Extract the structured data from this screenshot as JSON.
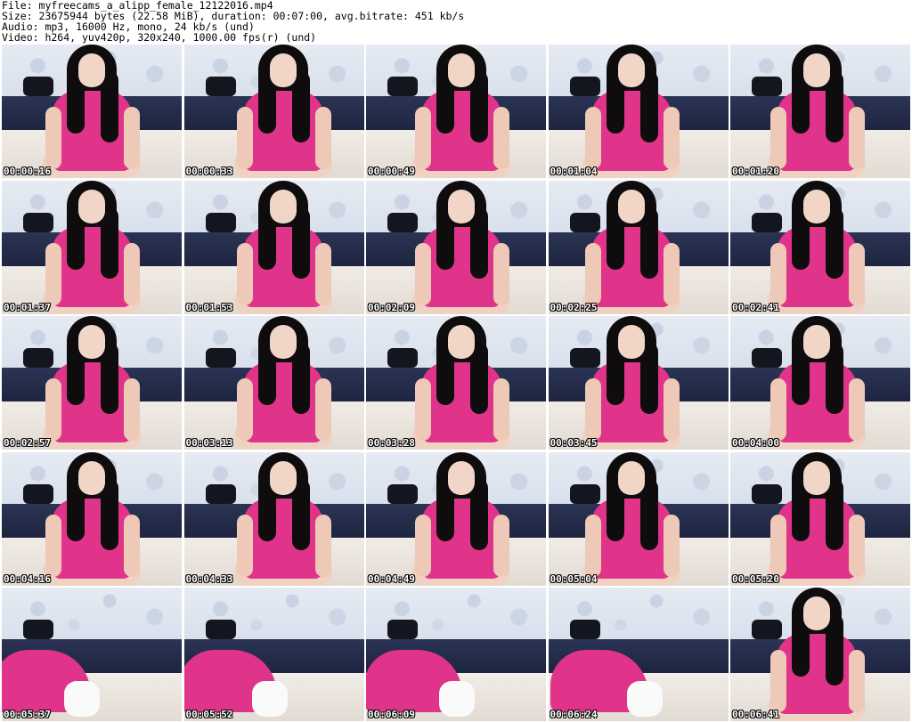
{
  "header": {
    "file": "File: myfreecams_a_alipp_female_12122016.mp4",
    "size": "Size: 23675944 bytes (22.58 MiB), duration: 00:07:00, avg.bitrate: 451 kb/s",
    "audio": "Audio: mp3, 16000 Hz, mono, 24 kb/s (und)",
    "video": "Video: h264, yuv420p, 320x240, 1000.00 fps(r) (und)"
  },
  "thumbnails": [
    {
      "time": "00:00:16"
    },
    {
      "time": "00:00:33"
    },
    {
      "time": "00:00:49"
    },
    {
      "time": "00:01:04"
    },
    {
      "time": "00:01:20"
    },
    {
      "time": "00:01:37"
    },
    {
      "time": "00:01:53"
    },
    {
      "time": "00:02:09"
    },
    {
      "time": "00:02:25"
    },
    {
      "time": "00:02:41"
    },
    {
      "time": "00:02:57"
    },
    {
      "time": "00:03:13"
    },
    {
      "time": "00:03:28"
    },
    {
      "time": "00:03:45"
    },
    {
      "time": "00:04:00"
    },
    {
      "time": "00:04:16"
    },
    {
      "time": "00:04:33"
    },
    {
      "time": "00:04:49"
    },
    {
      "time": "00:05:04"
    },
    {
      "time": "00:05:20"
    },
    {
      "time": "00:05:37"
    },
    {
      "time": "00:05:52"
    },
    {
      "time": "00:06:09"
    },
    {
      "time": "00:06:24"
    },
    {
      "time": "00:06:41"
    }
  ],
  "colors": {
    "shirt": "#e0338a",
    "hair": "#0f0c0e",
    "sofa": "#1d2440",
    "wallpaper": "#dfe6ef",
    "bed": "#ebe5de"
  }
}
